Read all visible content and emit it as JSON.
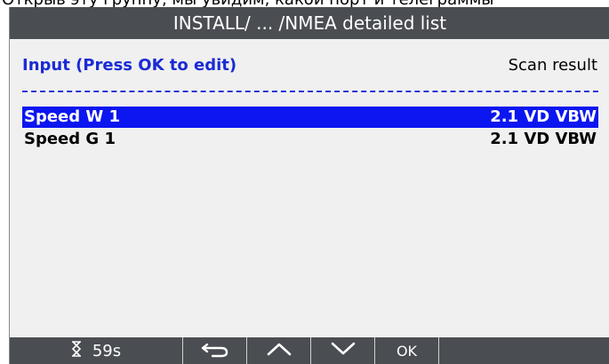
{
  "caption": "Открыв эту группу, мы увидим, какой порт и телеграммы",
  "title": "INSTALL/ ... /NMEA detailed list",
  "header": {
    "left": "Input (Press OK to edit)",
    "right": "Scan result"
  },
  "rows": [
    {
      "name": "Speed W 1",
      "value": "2.1 VD VBW",
      "selected": true
    },
    {
      "name": "Speed G 1",
      "value": "2.1 VD VBW",
      "selected": false
    }
  ],
  "bottombar": {
    "timer_icon": "hourglass-icon",
    "timer": "59s",
    "back_icon": "back-arrow-icon",
    "up_icon": "chevron-up-icon",
    "down_icon": "chevron-down-icon",
    "ok": "OK"
  },
  "colors": {
    "bar": "#4a4d52",
    "accent": "#1a2bd6",
    "selection": "#0c16f0",
    "background": "#f0f0f0"
  }
}
